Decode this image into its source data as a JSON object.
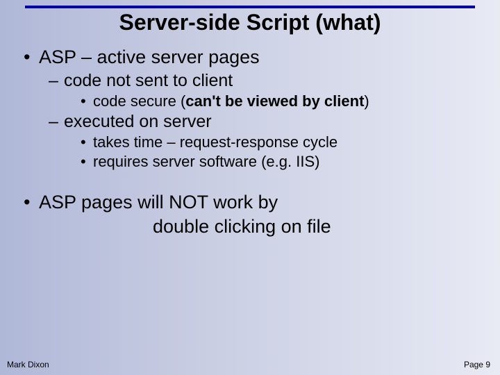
{
  "title": "Server-side Script (what)",
  "bullets": {
    "l1a": "ASP – active server pages",
    "l2a": "code not sent to client",
    "l3a_pre": "code secure (",
    "l3a_bold": "can't be viewed by client",
    "l3a_post": ")",
    "l2b": "executed on server",
    "l3b": "takes time – request-response cycle",
    "l3c": "requires server software (e.g. IIS)",
    "l1b": "ASP pages will NOT work by",
    "l1b_cont": "double clicking on file"
  },
  "footer": {
    "author": "Mark Dixon",
    "page": "Page 9"
  },
  "glyphs": {
    "dot": "•",
    "dash": "–"
  }
}
